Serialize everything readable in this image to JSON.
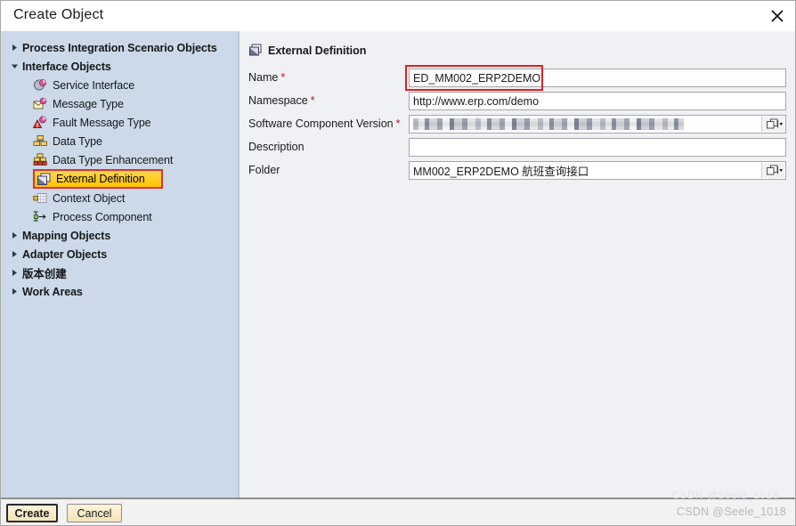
{
  "window": {
    "title": "Create Object",
    "close_icon": "close-icon"
  },
  "sidebar": {
    "nodes": [
      {
        "label": "Process Integration Scenario Objects",
        "type": "group",
        "expanded": false,
        "icon": "triangle-right-icon"
      },
      {
        "label": "Interface Objects",
        "type": "group",
        "expanded": true,
        "icon": "triangle-down-icon"
      },
      {
        "label": "Service Interface",
        "type": "leaf",
        "icon": "service-interface-icon",
        "selected": false
      },
      {
        "label": "Message Type",
        "type": "leaf",
        "icon": "message-type-icon",
        "selected": false
      },
      {
        "label": "Fault Message Type",
        "type": "leaf",
        "icon": "fault-message-type-icon",
        "selected": false
      },
      {
        "label": "Data Type",
        "type": "leaf",
        "icon": "data-type-icon",
        "selected": false
      },
      {
        "label": "Data Type Enhancement",
        "type": "leaf",
        "icon": "data-type-enhancement-icon",
        "selected": false
      },
      {
        "label": "External Definition",
        "type": "leaf",
        "icon": "external-definition-icon",
        "selected": true
      },
      {
        "label": "Context Object",
        "type": "leaf",
        "icon": "context-object-icon",
        "selected": false
      },
      {
        "label": "Process Component",
        "type": "leaf",
        "icon": "process-component-icon",
        "selected": false
      },
      {
        "label": "Mapping Objects",
        "type": "group",
        "expanded": false,
        "icon": "triangle-right-icon"
      },
      {
        "label": "Adapter Objects",
        "type": "group",
        "expanded": false,
        "icon": "triangle-right-icon"
      },
      {
        "label": "版本创建",
        "type": "group",
        "expanded": false,
        "icon": "triangle-right-icon"
      },
      {
        "label": "Work Areas",
        "type": "group",
        "expanded": false,
        "icon": "triangle-right-icon"
      }
    ]
  },
  "form": {
    "header": {
      "title": "External Definition",
      "icon": "external-definition-icon"
    },
    "fields": [
      {
        "label": "Name",
        "required": true,
        "value": "ED_MM002_ERP2DEMO",
        "placeholder": "",
        "help": false,
        "redacted": false,
        "highlighted": true
      },
      {
        "label": "Namespace",
        "required": true,
        "value": "http://www.erp.com/demo",
        "placeholder": "",
        "help": false,
        "redacted": false,
        "highlighted": false
      },
      {
        "label": "Software Component Version",
        "required": true,
        "value": "",
        "placeholder": "",
        "help": true,
        "redacted": true,
        "highlighted": false
      },
      {
        "label": "Description",
        "required": false,
        "value": "",
        "placeholder": "",
        "help": false,
        "redacted": false,
        "highlighted": false
      },
      {
        "label": "Folder",
        "required": false,
        "value": "MM002_ERP2DEMO 航班查询接口",
        "placeholder": "",
        "help": true,
        "redacted": false,
        "highlighted": false
      }
    ]
  },
  "footer": {
    "create_label": "Create",
    "cancel_label": "Cancel"
  },
  "watermark": {
    "text": "CSDN @Seele_1018"
  },
  "colors": {
    "sidebar_bg": "#cbd9e8",
    "panel_bg": "#f0f1f5",
    "selection_highlight": "#ffc400",
    "annotation_red": "#e32020",
    "required_red": "#c0102a",
    "button_face": "#f2e3b8"
  }
}
